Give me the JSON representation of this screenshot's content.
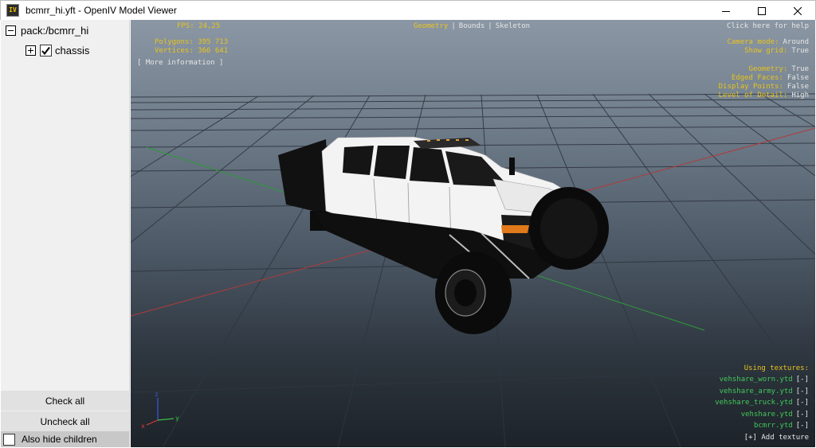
{
  "window": {
    "title": "bcmrr_hi.yft - OpenIV Model Viewer",
    "icon": "openiv-app-icon",
    "icon_text": "IV"
  },
  "tree": {
    "root_label": "pack:/bcmrr_hi",
    "child_label": "chassis",
    "child_checked": true
  },
  "panel": {
    "check_all": "Check all",
    "uncheck_all": "Uncheck all",
    "also_hide_children": "Also hide children"
  },
  "hud": {
    "fps_label": "FPS:",
    "fps_value": "24,25",
    "polygons_label": "Polygons:",
    "polygons_value": "395 713",
    "vertices_label": "Vertices:",
    "vertices_value": "366 641",
    "more_info": "[ More information ]",
    "modes": {
      "geometry": "Geometry",
      "bounds": "Bounds",
      "skeleton": "Skeleton",
      "separator": "|"
    },
    "help": "Click here for help",
    "camera_mode_label": "Camera mode:",
    "camera_mode_value": "Around",
    "show_grid_label": "Show grid:",
    "show_grid_value": "True",
    "geometry_label": "Geometry:",
    "geometry_value": "True",
    "edged_faces_label": "Edged Faces:",
    "edged_faces_value": "False",
    "display_points_label": "Display Points:",
    "display_points_value": "False",
    "lod_label": "Level of Detail:",
    "lod_value": "High",
    "using_textures": "Using textures:",
    "textures": [
      {
        "name": "vehshare_worn.ytd",
        "action": "[-]"
      },
      {
        "name": "vehshare_army.ytd",
        "action": "[-]"
      },
      {
        "name": "vehshare_truck.ytd",
        "action": "[-]"
      },
      {
        "name": "vehshare.ytd",
        "action": "[-]"
      },
      {
        "name": "bcmrr.ytd",
        "action": "[-]"
      }
    ],
    "add_texture": "[+] Add texture"
  },
  "axes": {
    "x": "x",
    "y": "y",
    "z": "z"
  },
  "colors": {
    "hud_yellow": "#e8c41c",
    "hud_white": "#e6e6e6",
    "hud_green": "#43c95a",
    "axis_x": "#d93a3a",
    "axis_y": "#3ac24a",
    "axis_z": "#3a5ad9"
  }
}
